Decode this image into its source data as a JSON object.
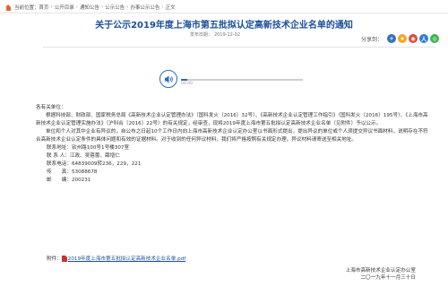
{
  "breadcrumb": {
    "prefix": "当前位置：",
    "items": [
      "首页",
      "公开目录",
      "通知公告",
      "公示公告",
      "办事公示公告",
      "正文"
    ],
    "sep": "›"
  },
  "title": "关于公示2019年度上海市第五批拟认定高新技术企业名单的通知",
  "meta": {
    "date_label": "发布日期：",
    "date": "2019-12-02"
  },
  "share": {
    "label": "分享到：",
    "icons": [
      "plus-icon",
      "qzone-icon",
      "weibo-icon",
      "renren-icon",
      "wechat-icon"
    ]
  },
  "audio": {
    "progress": 0.05,
    "time": "00:00"
  },
  "content": {
    "greeting": "各有关单位：",
    "para1": "根据科技部、财政部、国家税务总局《高新技术企业认定管理办法》（国科发火〔2016〕32号）、《高新技术企业认定管理工作指引》（国科发火〔2016〕195号）、《上海市高新技术企业认定管理实施办法》（沪科合〔2016〕22号）的有关规定，经审查，现将2019年度上海市第五批拟认定高新技术企业名单（见附件）予以公示。",
    "para2": "单位和个人对其中企业有异议的，自公布之日起10个工作日内向上海市高新技术企业认定办公室以书面形式提出，提出异议的单位或个人须提交异议书面材料，说明存在不符合高新技术企业认定条件的具体问题和有效的证据材料。对于收到的任何异议材料，我们将严格按照有关规定办理。异议材料请寄送至相关地址。",
    "contacts": [
      "联系地址：钦州路100号1号楼307室",
      "联 系 人：江政、吴蓓蕾、薛增仁",
      "联系电话：64839009转236，229，221",
      "传　　真：53088678",
      "邮　　编：200231"
    ]
  },
  "attachment": {
    "label": "附件：",
    "file": "2019年度上海市第五批拟认定高新技术企业名单.pdf"
  },
  "signature": {
    "org": "上海市高新技术企业认定办公室",
    "date": "二〇一九年十一月三十日"
  }
}
